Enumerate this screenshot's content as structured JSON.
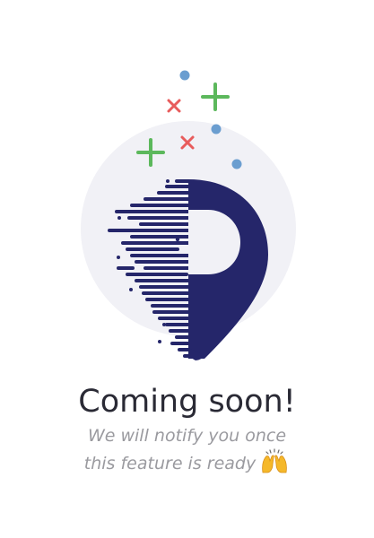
{
  "illustration": {
    "icon": "location-pin-icon",
    "decorations": [
      "plus-icon",
      "cross-icon",
      "dot-icon"
    ],
    "colors": {
      "pin": "#25266a",
      "circle": "#f1f1f6",
      "plus": "#5cb85c",
      "cross": "#e85c5c",
      "dot": "#6b9ed0"
    }
  },
  "message": {
    "title": "Coming soon!",
    "subtitle_line1": "We will notify you once",
    "subtitle_line2": "this feature is ready",
    "emoji": "raising-hands-icon"
  }
}
